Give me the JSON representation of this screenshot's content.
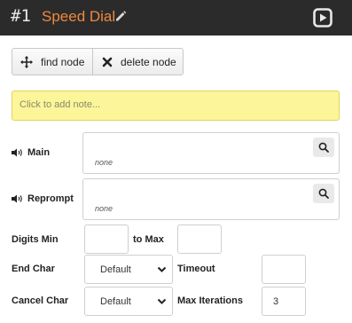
{
  "header": {
    "node_number": "#1",
    "node_title": "Speed Dial",
    "title_color": "#f0883e",
    "icons": [
      "pencil-icon",
      "play-square-icon"
    ]
  },
  "toolbar": {
    "find_label": "find node",
    "delete_label": "delete node",
    "find_icon": "crosshair-move-icon",
    "delete_icon": "x-icon"
  },
  "note": {
    "placeholder": "Click to add note..."
  },
  "prompts": {
    "main": {
      "label": "Main",
      "value": "none",
      "icon": "speaker-icon"
    },
    "reprompt": {
      "label": "Reprompt",
      "value": "none",
      "icon": "speaker-icon"
    }
  },
  "fields": {
    "digits_min": {
      "label": "Digits Min",
      "value": ""
    },
    "to_max": {
      "label": "to Max",
      "value": ""
    },
    "end_char": {
      "label": "End Char",
      "selected": "Default"
    },
    "timeout": {
      "label": "Timeout",
      "value": ""
    },
    "cancel_char": {
      "label": "Cancel Char",
      "selected": "Default"
    },
    "max_iterations": {
      "label": "Max Iterations",
      "value": "3"
    }
  }
}
